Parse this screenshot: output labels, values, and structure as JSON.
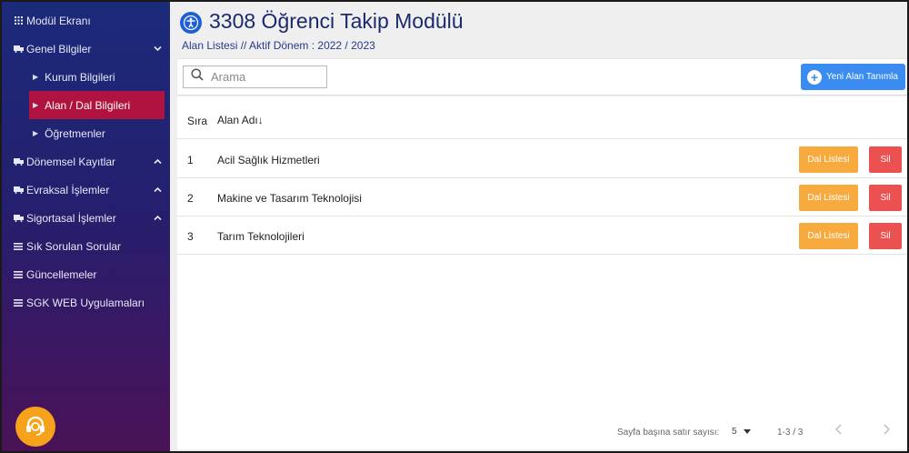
{
  "sidebar": {
    "items": [
      {
        "label": "Modül Ekranı",
        "icon": "grid-icon"
      },
      {
        "label": "Genel Bilgiler",
        "icon": "truck-icon",
        "expanded": true
      },
      {
        "label": "Dönemsel Kayıtlar",
        "icon": "truck-icon"
      },
      {
        "label": "Evraksal İşlemler",
        "icon": "truck-icon"
      },
      {
        "label": "Sigortasal İşlemler",
        "icon": "truck-icon"
      },
      {
        "label": "Sık Sorulan Sorular",
        "icon": "list-icon"
      },
      {
        "label": "Güncellemeler",
        "icon": "list-icon"
      },
      {
        "label": "SGK WEB Uygulamaları",
        "icon": "list-icon"
      }
    ],
    "sub_items": [
      {
        "label": "Kurum Bilgileri"
      },
      {
        "label": "Alan / Dal Bilgileri",
        "active": true
      },
      {
        "label": "Öğretmenler"
      }
    ]
  },
  "header": {
    "title": "3308 Öğrenci Takip Modülü",
    "subtitle": "Alan Listesi // Aktif Dönem : 2022 / 2023"
  },
  "toolbar": {
    "search_placeholder": "Arama",
    "new_button": "Yeni Alan Tanımla"
  },
  "table": {
    "headers": {
      "sira": "Sıra",
      "ad": "Alan Adı"
    },
    "sort_arrow": "↓",
    "rows": [
      {
        "sira": "1",
        "ad": "Acil Sağlık Hizmetleri"
      },
      {
        "sira": "2",
        "ad": "Makine ve Tasarım Teknolojisi"
      },
      {
        "sira": "3",
        "ad": "Tarım Teknolojileri"
      }
    ],
    "dal_button": "Dal Listesi",
    "sil_button": "Sil"
  },
  "footer": {
    "rows_per_page_label": "Sayfa başına satır sayısı:",
    "rows_per_page_value": "5",
    "range": "1-3 / 3"
  },
  "colors": {
    "active_nav": "#b0133f",
    "primary": "#3b8cf0",
    "warning": "#f7aa3d",
    "danger": "#ec5151",
    "support": "#f6a21b"
  }
}
